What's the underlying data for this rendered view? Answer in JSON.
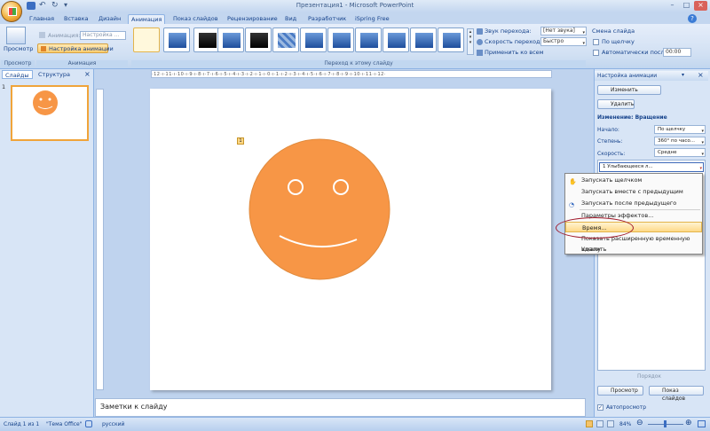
{
  "window": {
    "title": "Презентация1 - Microsoft PowerPoint"
  },
  "tabs": [
    "Главная",
    "Вставка",
    "Дизайн",
    "Анимация",
    "Показ слайдов",
    "Рецензирование",
    "Вид",
    "Разработчик",
    "iSpring Free"
  ],
  "ribbon": {
    "preview_label": "Просмотр",
    "animation_label": "Анимация:",
    "animation_value": "Настройка ...",
    "custom_animation": "Настройка анимации",
    "groups": {
      "preview": "Просмотр",
      "animation": "Анимация",
      "transition": "Переход к этому слайду"
    },
    "sound_label": "Звук перехода:",
    "sound_value": "[Нет звука]",
    "speed_label": "Скорость перехода:",
    "speed_value": "Быстро",
    "apply_all": "Применить ко всем",
    "advance_title": "Смена слайда",
    "on_click": "По щелчку",
    "auto_after": "Автоматически после:",
    "auto_time": "00:00"
  },
  "left_pane": {
    "tab_slides": "Слайды",
    "tab_outline": "Структура",
    "slide_number": "1"
  },
  "ruler_text": "·12·ı·11·ı·10·ı·9·ı·8·ı·7·ı·6·ı·5·ı·4·ı·3·ı·2·ı·1·ı·0·ı·1·ı·2·ı·3·ı·4·ı·5·ı·6·ı·7·ı·8·ı·9·ı·10·ı·11·ı·12·",
  "slide": {
    "animation_marker": "1",
    "face_color": "#f79646"
  },
  "notes_placeholder": "Заметки к слайду",
  "task_pane": {
    "title": "Настройка анимации",
    "change_button": "Изменить",
    "remove_button": "Удалить",
    "effect_title": "Изменение: Вращение",
    "start_label": "Начало:",
    "start_value": "По щелчку",
    "amount_label": "Степень:",
    "amount_value": "360° по часо...",
    "speed_label": "Скорость:",
    "speed_value": "Средне",
    "list_item": "1  Улыбающееся л...",
    "reorder_label": "Порядок",
    "play_button": "Просмотр",
    "slideshow_button": "Показ слайдов",
    "autopreview": "Автопросмотр"
  },
  "context_menu": {
    "items": [
      "Запускать щелчком",
      "Запускать вместе с предыдущим",
      "Запускать после предыдущего",
      "Параметры эффектов...",
      "Время...",
      "Показать расширенную временную шкалу",
      "Удалить"
    ]
  },
  "status_bar": {
    "slide_info": "Слайд 1 из 1",
    "theme": "\"Тема Office\"",
    "language": "русский",
    "zoom": "84%"
  }
}
